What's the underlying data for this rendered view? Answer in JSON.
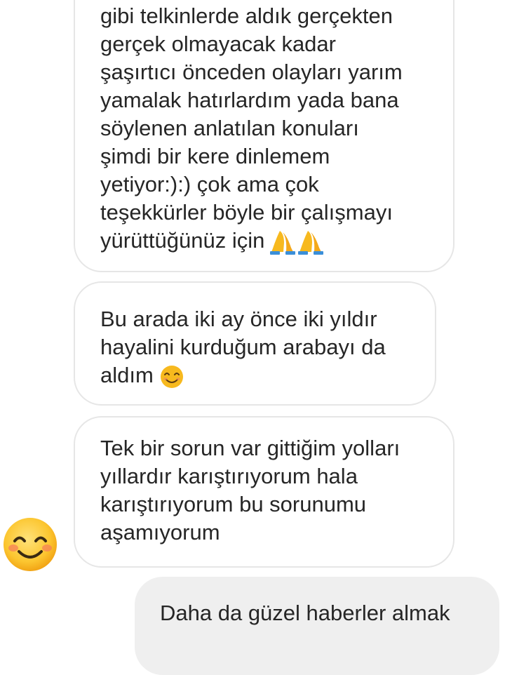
{
  "conversation": {
    "message_1": {
      "lines": [
        "gibi telkinlerde aldık gerçekten",
        "gerçek olmayacak kadar",
        "şaşırtıcı önceden olayları yarım",
        "yamalak hatırlardım yada bana",
        "söylenen anlatılan konuları",
        "şimdi bir kere dinlemem",
        "yetiyor:):) çok ama çok",
        "teşekkürler böyle bir çalışmayı",
        "yürüttüğünüz için"
      ],
      "emoji": "praying-hands"
    },
    "message_2": {
      "lines": [
        "Bu arada iki ay önce iki yıldır",
        "hayalini kurduğum arabayı da",
        "aldım"
      ],
      "emoji": "smiling-face"
    },
    "message_3": {
      "lines": [
        "Tek bir sorun var gittiğim yolları",
        "yıllardır karıştırıyorum hala",
        "karıştırıyorum bu sorunumu",
        "aşamıyorum"
      ]
    },
    "sender_avatar": "smiling-face-with-blush-icon",
    "sent_message": {
      "lines": [
        "Daha da güzel haberler almak"
      ]
    }
  },
  "colors": {
    "received_bubble_border": "#e6e6e6",
    "sent_bubble_background": "#efefef",
    "text": "#262626",
    "emoji_yellow": "#f7b91e"
  }
}
